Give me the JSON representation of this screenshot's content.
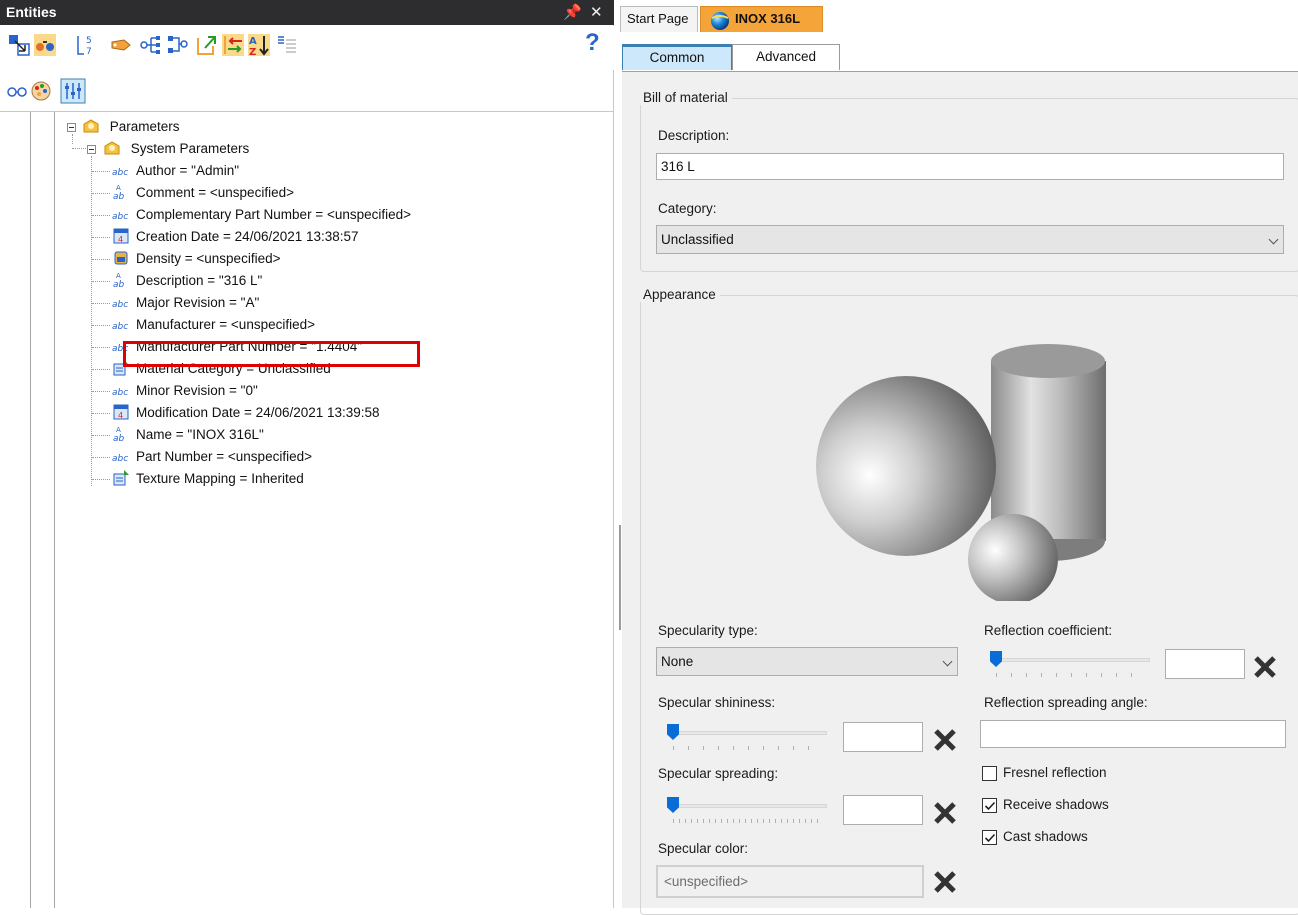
{
  "left_panel": {
    "title": "Entities",
    "pin_glyph": "ⅹ",
    "close_glyph": "✕",
    "help_glyph": "?",
    "toolbar1_icons": [
      "select-entities-icon",
      "link-entities-icon",
      "numbering-icon",
      "tag-icon",
      "tree-hierarchy-icon",
      "tree-structure-icon",
      "export-icon",
      "switch-icon",
      "sort-az-icon",
      "filter-list-icon"
    ],
    "toolbar2_icons": [
      "visibility-icon",
      "color-palette-icon",
      "parameters-filter-icon"
    ],
    "tree": {
      "root": "Parameters",
      "group": "System Parameters",
      "items": [
        {
          "icon": "abc",
          "text": "Author = \"Admin\""
        },
        {
          "icon": "aab",
          "text": "Comment = <unspecified>"
        },
        {
          "icon": "abc",
          "text": "Complementary Part Number = <unspecified>"
        },
        {
          "icon": "date",
          "text": "Creation Date = 24/06/2021 13:38:57"
        },
        {
          "icon": "density",
          "text": "Density = <unspecified>"
        },
        {
          "icon": "aab",
          "text": "Description = \"316 L\""
        },
        {
          "icon": "abc",
          "text": "Major Revision = \"A\""
        },
        {
          "icon": "abc",
          "text": "Manufacturer = <unspecified>"
        },
        {
          "icon": "abc",
          "text": "Manufacturer Part Number = \"1.4404\""
        },
        {
          "icon": "enum",
          "text": "Material Category = Unclassified"
        },
        {
          "icon": "abc",
          "text": "Minor Revision = \"0\""
        },
        {
          "icon": "date",
          "text": "Modification Date = 24/06/2021 13:39:58"
        },
        {
          "icon": "aab",
          "text": "Name = \"INOX 316L\""
        },
        {
          "icon": "abc",
          "text": "Part Number = <unspecified>"
        },
        {
          "icon": "enum",
          "text": "Texture Mapping = Inherited"
        }
      ]
    }
  },
  "right_panel": {
    "doc_tabs": {
      "start": "Start Page",
      "active": "INOX 316L"
    },
    "sub_tabs": {
      "common": "Common",
      "advanced": "Advanced"
    },
    "bill_of_material": {
      "group_title": "Bill of material",
      "description_label": "Description:",
      "description_value": "316 L",
      "category_label": "Category:",
      "category_value": "Unclassified"
    },
    "appearance": {
      "group_title": "Appearance",
      "specularity_type_label": "Specularity type:",
      "specularity_type_value": "None",
      "specular_shininess_label": "Specular shininess:",
      "specular_spreading_label": "Specular spreading:",
      "specular_color_label": "Specular color:",
      "specular_color_value": "<unspecified>",
      "reflection_coefficient_label": "Reflection coefficient:",
      "reflection_spreading_angle_label": "Reflection spreading angle:",
      "fresnel_label": "Fresnel reflection",
      "fresnel_checked": false,
      "receive_shadows_label": "Receive shadows",
      "receive_shadows_checked": true,
      "cast_shadows_label": "Cast shadows",
      "cast_shadows_checked": true,
      "slider_levels": {
        "specular_shininess": 0,
        "specular_spreading": 0,
        "reflection_coefficient": 0
      }
    },
    "colors": {
      "accent": "#0a6cd7",
      "active_tab": "#f5a43a",
      "highlight": "#e00000"
    }
  }
}
